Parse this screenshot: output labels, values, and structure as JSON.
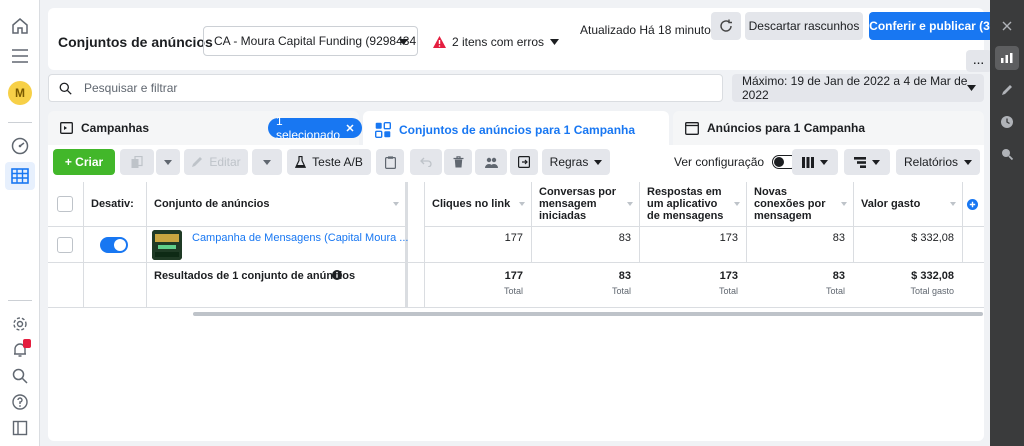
{
  "header": {
    "title": "Conjuntos de anúncios",
    "account": "CA - Moura Capital Funding (9298434...",
    "errors": "2 itens com erros",
    "updated": "Atualizado Há 18 minutos",
    "discard_label": "Descartar rascunhos",
    "publish_label": "Conferir e publicar (3)",
    "more_label": "..."
  },
  "left_nav": {
    "avatar_letter": "M"
  },
  "search": {
    "placeholder": "Pesquisar e filtrar",
    "date_range": "Máximo: 19 de Jan de 2022 a 4 de Mar de 2022"
  },
  "tabs": {
    "campaigns": "Campanhas",
    "selected_chip": "1 selecionado",
    "adsets": "Conjuntos de anúncios para 1 Campanha",
    "ads": "Anúncios para 1 Campanha"
  },
  "toolbar": {
    "create": "+ Criar",
    "edit": "Editar",
    "ab_test": "Teste A/B",
    "rules": "Regras",
    "view_config": "Ver configuração",
    "reports": "Relatórios"
  },
  "table": {
    "columns": {
      "off": "Desativ:",
      "adset": "Conjunto de anúncios",
      "clicks": "Cliques no link",
      "conversations": "Conversas por mensagem iniciadas",
      "replies": "Respostas em um aplicativo de mensagens",
      "connections": "Novas conexões por mensagem",
      "spent": "Valor gasto"
    },
    "row": {
      "name": "Campanha de Mensagens (Capital Moura ...",
      "clicks": "177",
      "conversations": "83",
      "replies": "173",
      "connections": "83",
      "spent": "$ 332,08"
    },
    "totals": {
      "label": "Resultados de 1 conjunto de anúncios",
      "clicks": "177",
      "conversations": "83",
      "replies": "173",
      "connections": "83",
      "spent": "$ 332,08",
      "total_label": "Total",
      "spent_label": "Total gasto"
    }
  }
}
